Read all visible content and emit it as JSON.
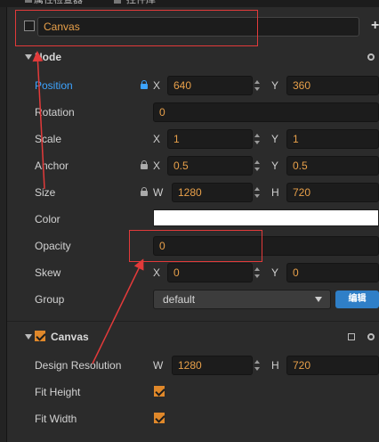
{
  "tabs": [
    {
      "label": "属性检查器"
    },
    {
      "label": "控件库"
    }
  ],
  "node": {
    "name": "Canvas"
  },
  "sections": {
    "node_title": "Node",
    "canvas_title": "Canvas"
  },
  "props": {
    "position": {
      "label": "Position",
      "x_axis": "X",
      "y_axis": "Y",
      "x": "640",
      "y": "360"
    },
    "rotation": {
      "label": "Rotation",
      "value": "0"
    },
    "scale": {
      "label": "Scale",
      "x_axis": "X",
      "y_axis": "Y",
      "x": "1",
      "y": "1"
    },
    "anchor": {
      "label": "Anchor",
      "x_axis": "X",
      "y_axis": "Y",
      "x": "0.5",
      "y": "0.5"
    },
    "size": {
      "label": "Size",
      "w_axis": "W",
      "h_axis": "H",
      "w": "1280",
      "h": "720"
    },
    "color": {
      "label": "Color",
      "value": "#ffffff"
    },
    "opacity": {
      "label": "Opacity",
      "value": "0"
    },
    "skew": {
      "label": "Skew",
      "x_axis": "X",
      "y_axis": "Y",
      "x": "0",
      "y": "0"
    },
    "group": {
      "label": "Group",
      "value": "default",
      "edit_label": "编辑"
    }
  },
  "canvas": {
    "design_resolution": {
      "label": "Design Resolution",
      "w_axis": "W",
      "h_axis": "H",
      "w": "1280",
      "h": "720"
    },
    "fit_height": {
      "label": "Fit Height",
      "checked": true
    },
    "fit_width": {
      "label": "Fit Width",
      "checked": true
    }
  },
  "add_label": "+",
  "colors": {
    "accent": "#e0882a",
    "blue": "#3da4ff",
    "annotation": "#e23a3a"
  }
}
